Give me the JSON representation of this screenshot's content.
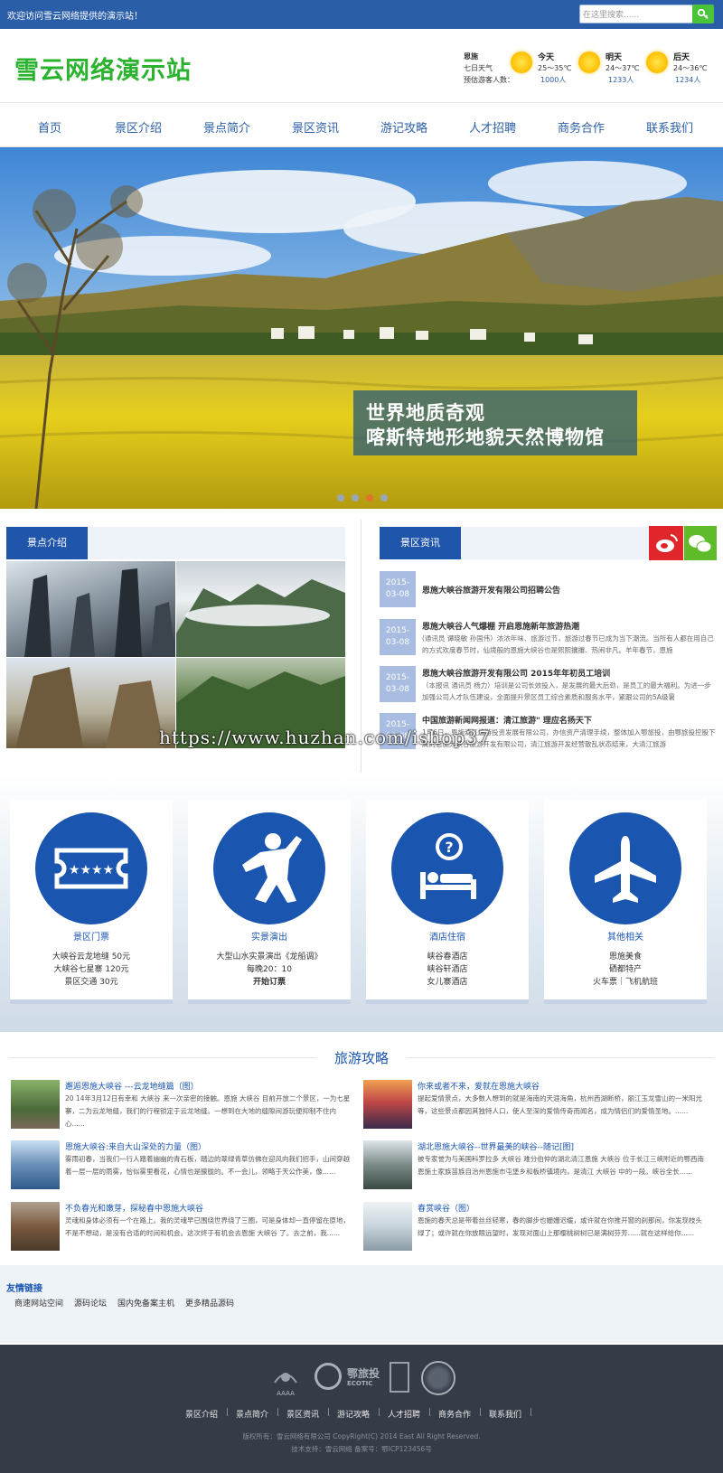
{
  "topbar": {
    "welcome": "欢迎访问雪云网络提供的演示站！",
    "search_placeholder": "在这里搜索......"
  },
  "header": {
    "logo": "雪云网络演示站",
    "weather": {
      "city": "恩施",
      "label7": "七日天气",
      "visitors_label": "预估游客人数：",
      "days": [
        {
          "day": "今天",
          "temp": "25～35℃",
          "count": "1000人"
        },
        {
          "day": "明天",
          "temp": "24～37℃",
          "count": "1233人"
        },
        {
          "day": "后天",
          "temp": "24～36℃",
          "count": "1234人"
        }
      ]
    }
  },
  "nav": [
    "首页",
    "景区介绍",
    "景点简介",
    "景区资讯",
    "游记攻略",
    "人才招聘",
    "商务合作",
    "联系我们"
  ],
  "banner": {
    "line1": "世界地质奇观",
    "line2": "喀斯特地形地貌天然博物馆"
  },
  "intro": {
    "title": "景点介绍"
  },
  "news": {
    "title": "景区资讯",
    "items": [
      {
        "date1": "2015-",
        "date2": "03-08",
        "title": "恩施大峡谷旅游开发有限公司招聘公告",
        "body": ""
      },
      {
        "date1": "2015-",
        "date2": "03-08",
        "title": "恩施大峡谷人气爆棚 开启恩施新年旅游热潮",
        "body": "(通讯员 谭晓敏 孙国伟）浓浓年味、旅游过节，旅游过春节已成为当下潮流。当所有人都在用自己的方式欢度春节时，仙境般的恩施大峡谷也是熙熙攘攘、热闹非凡。羊年春节，恩施"
      },
      {
        "date1": "2015-",
        "date2": "03-08",
        "title": "恩施大峡谷旅游开发有限公司 2015年年初员工培训",
        "body": "（本报讯 通讯员 杨力）培训是公司长效投入，是发展的最大后劲，是员工的最大福利。为进一步加强公司人才队伍建设，全面提升景区员工综合素质和服务水平，紧跟公司的5A级暑"
      },
      {
        "date1": "2015-",
        "date2": "03-08",
        "title": "中国旅游新闻网报道：清江旅游\" 理应名扬天下",
        "body": "1月6日，恩施清江旅游投资发展有限公司，办信资产清理手续，整体加入鄂旅投，由鄂旅投控股下属的恩施大峡谷旅游开发有限公司，清江旅游开发经营散乱状态结束，大清江旅游"
      }
    ]
  },
  "watermark": "https://www.huzhan.com/ishop37",
  "services": [
    {
      "title": "景区门票",
      "lines": [
        "大峡谷云龙地缝 50元",
        "大峡谷七星寨 120元",
        "景区交通 30元"
      ],
      "bold_last": false
    },
    {
      "title": "实景演出",
      "lines": [
        "大型山水实景演出《龙船调》",
        "每晚20：10",
        "开始订票"
      ],
      "bold_last": true
    },
    {
      "title": "酒店住宿",
      "lines": [
        "峡谷春酒店",
        "峡谷轩酒店",
        "女儿寨酒店"
      ],
      "bold_last": false
    },
    {
      "title": "其他相关",
      "lines": [
        "恩施美食",
        "硒都特产",
        "火车票｜飞机航班"
      ],
      "bold_last": false
    }
  ],
  "strategy": {
    "title": "旅游攻略",
    "items": [
      {
        "title": "邂逅恩施大峡谷 ---云龙地缝篇（图）",
        "body": "20 14年3月12日有幸和 大峡谷 来一次亲密的接触。恩施 大峡谷 目前开放二个景区，一为七星寨，二为云龙地缝，我们的行程锁定于云龙地缝。一想到在大地的缝隙间游玩便抑制不住内心......"
      },
      {
        "title": "你来或者不来，爱就在恩施大峡谷",
        "body": "提起爱情景点，大多数人想到的就是海南的天涯海角，杭州西湖断桥，丽江玉龙雪山的一米阳光等，这些景点都因其独特人口，使人至深的爱情传奇而闻名，成为情侣们的爱情圣地。......"
      },
      {
        "title": "恩施大峡谷:来自大山深处的力量（图）",
        "body": "雾雨初春，当我们一行人踏着幽幽的青石板，踏边的翠绿青草仿佛在迎风向我们招手，山间穿越着一层一层的雨雾，恰似雾里看花，心情也是朦胧的。不一会儿，领略于天公作美，像......"
      },
      {
        "title": "湖北恩施大峡谷--世界最美的峡谷--随记[图]",
        "body": "被专家誉为与美国科罗拉多 大峡谷 难分伯仲的湖北清江恩施 大峡谷 位于长江三峡附近的鄂西南恩施土家族苗族自治州恩施市屯堡乡和板桥镇境内，是清江 大峡谷 中的一段。峡谷全长......"
      },
      {
        "title": "不负春光和嫩芽，探秘春中恩施大峡谷",
        "body": "灵魂和身体必须有一个在路上。我的灵魂早已围绕世界绕了三圈，可是身体却一直停留在原地，不是不想动，是没有合适的时间和机会。这次终于有机会去恩施 大峡谷 了。去之前，我......"
      },
      {
        "title": "春赏峡谷（图）",
        "body": "恩施的春天总是带着丝丝轻寒，春的脚步也姗姗迟缓，或许就在你推开窗的刹那间，你发现枝头绿了；或许就在你放眼远望时，发现对面山上那樱桃树树已是满树芬芳......就在这样给你......"
      }
    ]
  },
  "friends": {
    "title": "友情链接",
    "links": [
      "商速网站空间",
      "源码论坛",
      "国内免备案主机",
      "更多精品源码"
    ]
  },
  "footer": {
    "logos": [
      "AAAA",
      "鄂旅投",
      "ECOTIC"
    ],
    "nav": [
      "景区介绍",
      "景点简介",
      "景区资讯",
      "游记攻略",
      "人才招聘",
      "商务合作",
      "联系我们"
    ],
    "copyright": "版权所有：雪云网络有限公司 CopyRight(C) 2014 East All Right Reserved.",
    "support": "技术支持：雪云网络 备案号：鄂ICP123456号"
  }
}
